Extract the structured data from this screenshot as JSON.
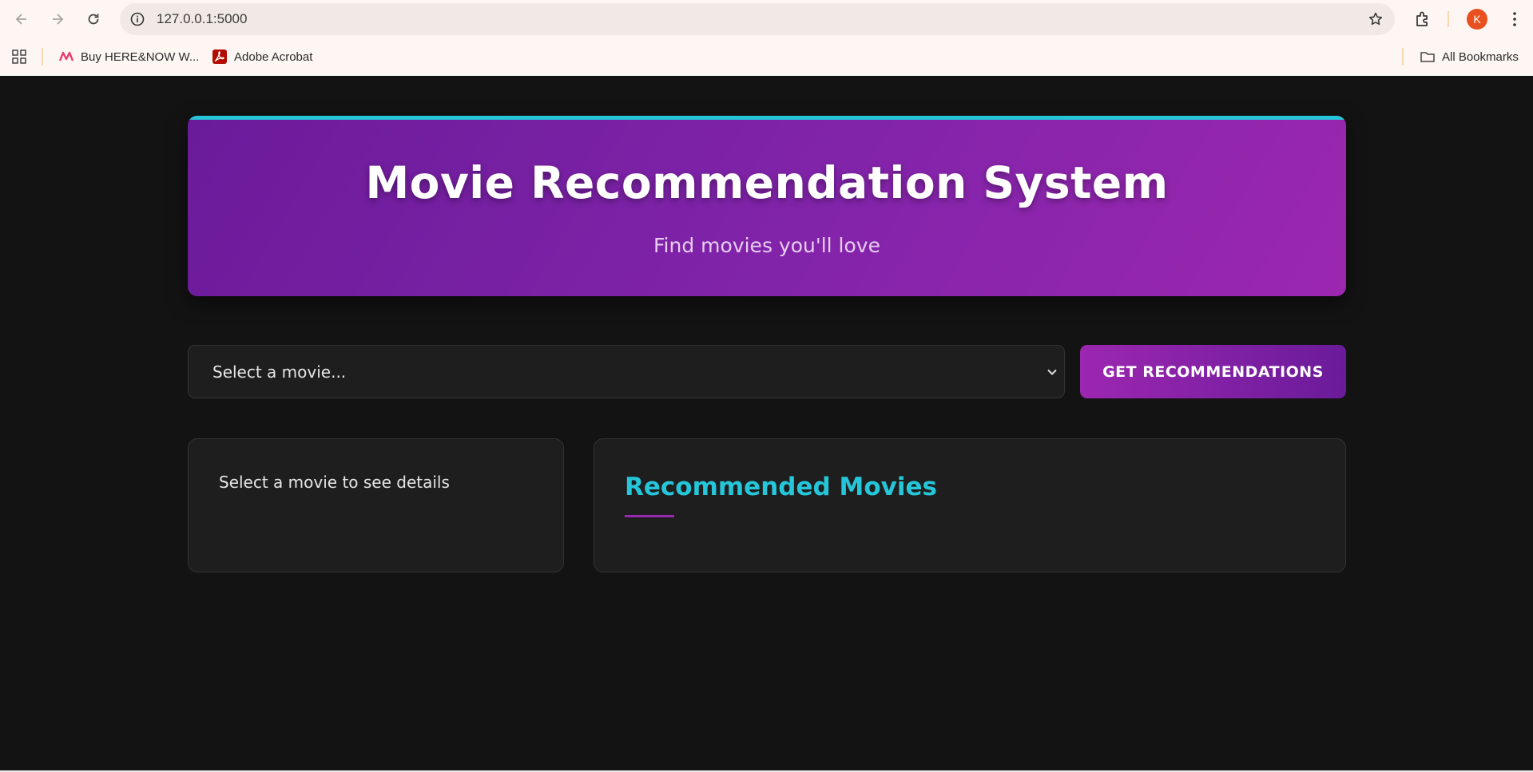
{
  "browser": {
    "url": "127.0.0.1:5000",
    "profile_initial": "K",
    "bookmarks": [
      {
        "label": "Buy HERE&NOW W..."
      },
      {
        "label": "Adobe Acrobat"
      }
    ],
    "all_bookmarks_label": "All Bookmarks"
  },
  "hero": {
    "title": "Movie Recommendation System",
    "subtitle": "Find movies you'll love"
  },
  "search": {
    "select_value": "Select a movie...",
    "button_label": "GET RECOMMENDATIONS"
  },
  "details": {
    "message": "Select a movie to see details"
  },
  "recommendations": {
    "heading": "Recommended Movies"
  },
  "colors": {
    "page_bg": "#131313",
    "card_bg": "#1e1e1e",
    "accent_purple": "#9c27b0",
    "accent_cyan": "#26c6da"
  }
}
